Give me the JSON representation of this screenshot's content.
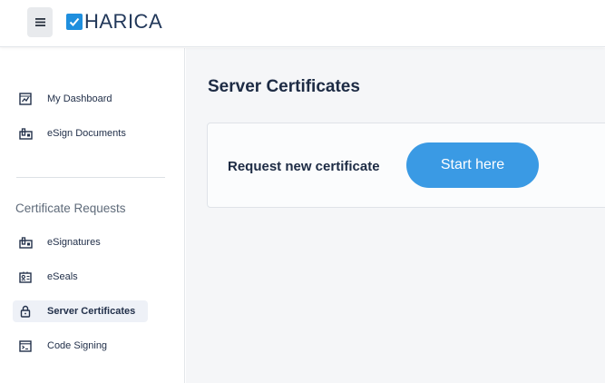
{
  "header": {
    "logo_text": "HARICA",
    "brand_color": "#1f8fde",
    "menu_icon": "hamburger-icon"
  },
  "sidebar": {
    "items_top": [
      {
        "label": "My Dashboard",
        "icon": "dashboard-icon"
      },
      {
        "label": "eSign Documents",
        "icon": "esign-icon"
      }
    ],
    "section_title": "Certificate Requests",
    "items_requests": [
      {
        "label": "eSignatures",
        "icon": "esign-icon",
        "active": false
      },
      {
        "label": "eSeals",
        "icon": "seal-icon",
        "active": false
      },
      {
        "label": "Server Certificates",
        "icon": "lock-icon",
        "active": true
      },
      {
        "label": "Code Signing",
        "icon": "code-icon",
        "active": false
      }
    ]
  },
  "main": {
    "title": "Server Certificates",
    "card": {
      "label": "Request new certificate",
      "button_label": "Start here",
      "button_color": "#3a9ae4"
    }
  }
}
